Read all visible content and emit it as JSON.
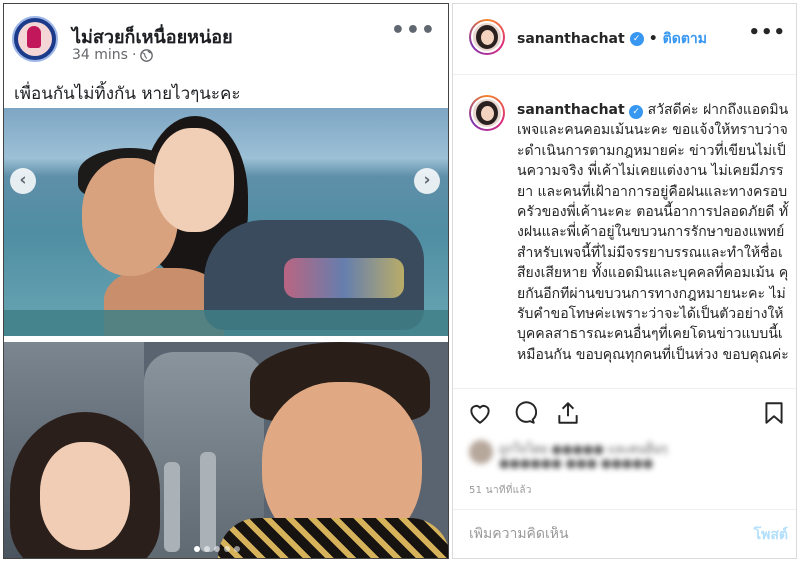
{
  "facebook": {
    "page_name": "ไม่สวยก็เหนื่อยหน่อย",
    "time": "34 mins",
    "separator": "·",
    "privacy_icon": "globe-icon",
    "more_icon": "more-icon",
    "caption": "เพื่อนกันไม่ทิ้งกัน หายไวๆนะคะ",
    "carousel": {
      "prev_label": "‹",
      "next_label": "›",
      "dot_count": 5,
      "active_dot": 0
    }
  },
  "instagram": {
    "header": {
      "username": "sananthachat",
      "verified_icon": "verified-badge-icon",
      "verified_mark": "✓",
      "dot": "•",
      "follow_label": "ติดตาม",
      "more_icon": "more-icon"
    },
    "caption": {
      "username": "sananthachat",
      "text": "สวัสดีค่ะ ฝากถึงแอดมินเพจและคนคอมเม้นนะคะ ขอแจ้งให้ทราบว่าจะดำเนินการตามกฎหมายค่ะ ข่าวที่เขียนไม่เป็นความจริง พี่เค้าไม่เคยแต่งงาน ไม่เคยมีภรรยา และคนที่เฝ้าอาการอยู่คือฝนและทางครอบครัวของพี่เค้านะคะ ตอนนี้อาการปลอดภัยดี ทั้งฝนและพี่เค้าอยู่ในขบวนการรักษาของแพทย์ สำหรับเพจนี้ที่ไม่มีจรรยาบรรณและทำให้ชื่อเสียงเสียหาย ทั้งแอดมินและบุคคลที่คอมเม้น คุยกันอีกทีผ่านขบวนการทางกฎหมายนะคะ ไม่รับคำขอโทษค่ะเพราะว่าจะได้เป็นตัวอย่างให้บุคคลสาธารณะคนอื่นๆที่เคยโดนข่าวแบบนี้เหมือนกัน ขอบคุณทุกคนที่เป็นห่วง ขอบคุณค่ะ"
    },
    "actions": {
      "like_icon": "heart-icon",
      "comment_icon": "comment-icon",
      "share_icon": "share-icon",
      "save_icon": "bookmark-icon"
    },
    "likes_blurred": {
      "line1": "ถูกใจโดย ●●●●● และคนอื่นๆ",
      "line2": "●●●●●● ●●● ●●●●●"
    },
    "timestamp": "51 นาทีที่แล้ว",
    "comment": {
      "placeholder": "เพิ่มความคิดเห็น",
      "post_label": "โพสต์"
    },
    "colors": {
      "link_blue": "#3897f0",
      "post_disabled": "#b2dffc",
      "muted": "#999999"
    }
  }
}
